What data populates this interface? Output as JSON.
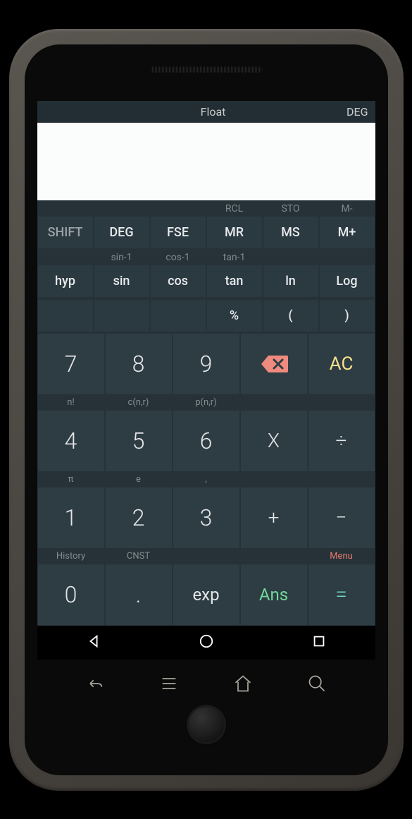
{
  "status": {
    "mode": "Float",
    "angle": "DEG"
  },
  "sec_row1": [
    "",
    "",
    "",
    "RCL",
    "STO",
    "M-"
  ],
  "fn_row1": [
    "SHIFT",
    "DEG",
    "FSE",
    "MR",
    "MS",
    "M+"
  ],
  "sec_row2": [
    "",
    "sin-1",
    "cos-1",
    "tan-1",
    "",
    ""
  ],
  "fn_row2": [
    "hyp",
    "sin",
    "cos",
    "tan",
    "ln",
    "Log"
  ],
  "fn_row3": [
    "",
    "",
    "",
    "%",
    "(",
    ")"
  ],
  "num_sec": {
    "r2": [
      "n!",
      "c(n,r)",
      "p(n,r)",
      "",
      ""
    ],
    "r3": [
      "π",
      "e",
      ",",
      "",
      ""
    ],
    "r4": [
      "History",
      "CNST",
      "",
      "",
      "Menu"
    ]
  },
  "pad": {
    "n7": "7",
    "n8": "8",
    "n9": "9",
    "ac": "AC",
    "n4": "4",
    "n5": "5",
    "n6": "6",
    "mul": "X",
    "div": "÷",
    "n1": "1",
    "n2": "2",
    "n3": "3",
    "add": "+",
    "sub": "−",
    "n0": "0",
    "dot": ".",
    "exp": "exp",
    "ans": "Ans",
    "eq": "="
  }
}
